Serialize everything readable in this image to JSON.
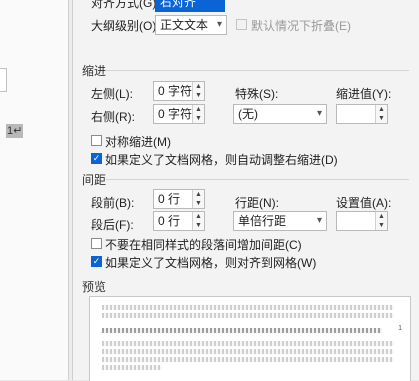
{
  "general": {
    "alignment_label": "对齐方式(G):",
    "alignment_value": "右对齐",
    "outline_label": "大纲级别(O):",
    "outline_value": "正文文本",
    "collapse_label": "默认情况下折叠(E)"
  },
  "indent": {
    "section_title": "缩进",
    "left_label": "左侧(L):",
    "left_value": "0 字符",
    "right_label": "右侧(R):",
    "right_value": "0 字符",
    "special_label": "特殊(S):",
    "special_value": "(无)",
    "indent_value_label": "缩进值(Y):",
    "indent_value": "",
    "mirror_label": "对称缩进(M)",
    "mirror_checked": false,
    "grid_adjust_label": "如果定义了文档网格，则自动调整右缩进(D)",
    "grid_adjust_checked": true
  },
  "spacing": {
    "section_title": "间距",
    "before_label": "段前(B):",
    "before_value": "0 行",
    "after_label": "段后(F):",
    "after_value": "0 行",
    "line_label": "行距(N):",
    "line_value": "单倍行距",
    "setting_label": "设置值(A):",
    "setting_value": "",
    "no_space_label": "不要在相同样式的段落间增加间距(C)",
    "no_space_checked": false,
    "snap_grid_label": "如果定义了文档网格，则对齐到网格(W)",
    "snap_grid_checked": true
  },
  "preview": {
    "section_title": "预览",
    "page_number": "1"
  },
  "document": {
    "cursor_text": "1↵"
  },
  "icons": {
    "dropdown": "chevron-down-icon",
    "spin_up": "spin-up-icon",
    "spin_down": "spin-down-icon",
    "check": "checkmark-icon"
  },
  "colors": {
    "accent": "#0a64d6",
    "dialog_bg": "#f3f3f3"
  }
}
